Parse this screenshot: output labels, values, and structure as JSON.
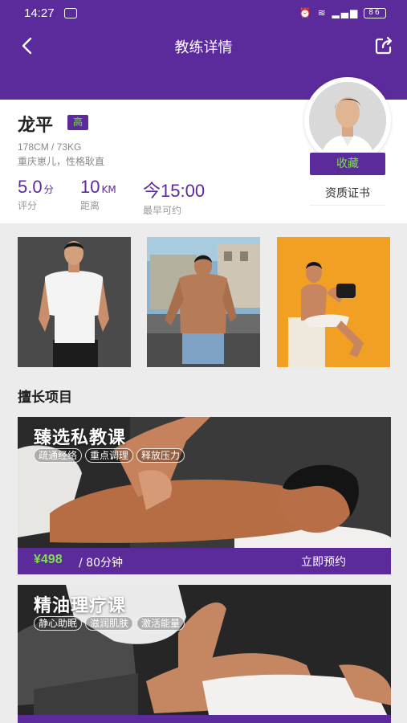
{
  "status_bar": {
    "time": "14:27",
    "battery": "86"
  },
  "header": {
    "title": "教练详情"
  },
  "coach": {
    "name": "龙平",
    "level": "高",
    "body": "178CM / 73KG",
    "location": "重庆崽儿，性格耿直",
    "stats": [
      {
        "value": "5.0",
        "unit": "分",
        "label": "评分"
      },
      {
        "value": "10",
        "unit": "KM",
        "label": "距离"
      },
      {
        "value": "今15:00",
        "unit": "",
        "label": "最早可约"
      }
    ],
    "favorite_label": "收藏",
    "certificate_label": "资质证书"
  },
  "section_title": "擅长项目",
  "courses": [
    {
      "title": "臻选私教课",
      "tags": [
        "疏通经络",
        "重点调理",
        "释放压力"
      ],
      "price": "¥498",
      "duration": "/ 80分钟",
      "book_label": "立即预约"
    },
    {
      "title": "精油理疗课",
      "tags": [
        "静心助眠",
        "滋润肌肤",
        "激活能量"
      ]
    }
  ],
  "colors": {
    "brand": "#5b2a9b",
    "accent": "#7fe04a"
  }
}
